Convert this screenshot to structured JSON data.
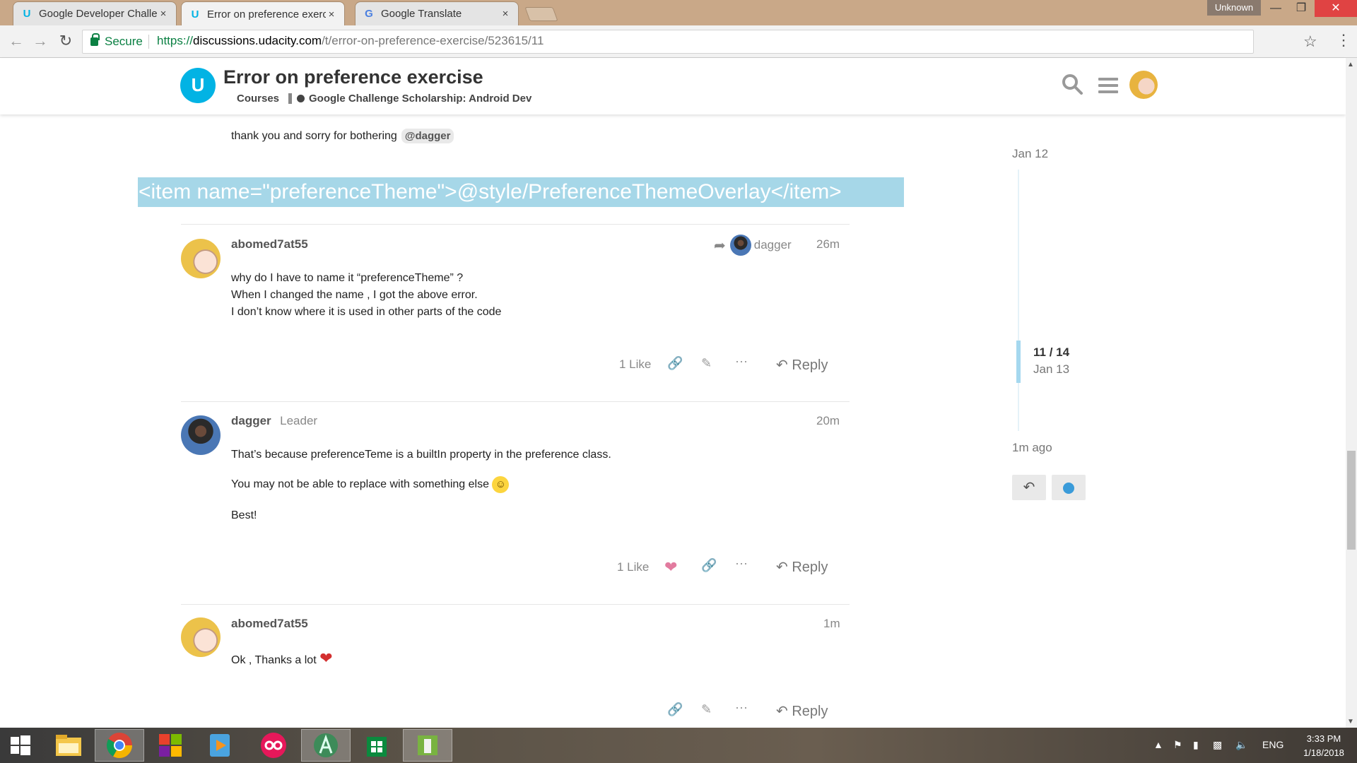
{
  "browser": {
    "tabs": [
      {
        "label": "Google Developer Challe",
        "icon": "udacity-icon",
        "active": false
      },
      {
        "label": "Error on preference exerc",
        "icon": "udacity-icon",
        "active": true
      },
      {
        "label": "Google Translate",
        "icon": "google-translate-icon",
        "active": false
      }
    ],
    "close_glyph": "×",
    "profile_label": "Unknown",
    "secure_label": "Secure",
    "url_scheme": "https://",
    "url_host": "discussions.udacity.com",
    "url_path": "/t/error-on-preference-exercise/523615/11"
  },
  "site": {
    "logo_glyph": "U",
    "topic_title": "Error on preference exercise",
    "category": "Courses",
    "subcategory": "Google Challenge Scholarship: Android Dev"
  },
  "previous_post": {
    "text": "thank you and sorry for bothering",
    "mention": "@dagger"
  },
  "selected_text": "<item name=\"preferenceTheme\">@style/PreferenceThemeOverlay</item>",
  "posts": [
    {
      "username": "abomed7at55",
      "reply_to": "dagger",
      "time": "26m",
      "lines": [
        "why do I have to name it “preferenceTheme” ?",
        "When I changed the name , I got the above error.",
        "I don’t know where it is used in other parts of the code"
      ],
      "likes": "1 Like",
      "reply_label": "Reply"
    },
    {
      "username": "dagger",
      "flair": "Leader",
      "time": "20m",
      "lines": [
        "That’s because preferenceTeme is a builtIn property in the preference class.",
        "You may not be able to replace with something else",
        "Best!"
      ],
      "likes": "1 Like",
      "reply_label": "Reply"
    },
    {
      "username": "abomed7at55",
      "time": "1m",
      "lines": [
        "Ok , Thanks a lot"
      ],
      "reply_label": "Reply"
    }
  ],
  "timeline": {
    "start_date": "Jan 12",
    "position": "11 / 14",
    "position_date": "Jan 13",
    "end_label": "1m ago"
  },
  "taskbar": {
    "language": "ENG",
    "time": "3:33 PM",
    "date": "1/18/2018"
  },
  "colors": {
    "udacity_blue": "#02b3e4",
    "selection": "#a6d7e8",
    "secure_green": "#0b8043"
  }
}
